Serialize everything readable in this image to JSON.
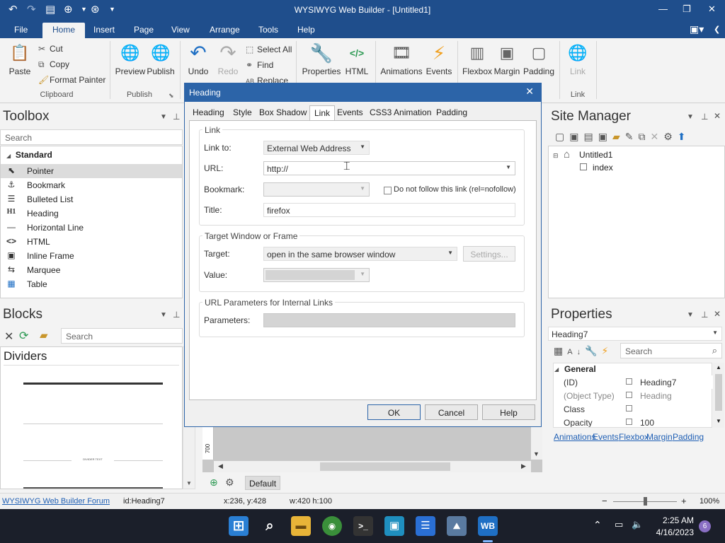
{
  "app": {
    "title": "WYSIWYG Web Builder - [Untitled1]",
    "window_controls": {
      "minimize": "—",
      "maximize": "❐",
      "close": "✕"
    }
  },
  "menu": [
    "File",
    "Home",
    "Insert",
    "Page",
    "View",
    "Arrange",
    "Tools",
    "Help"
  ],
  "ribbon": {
    "paste": "Paste",
    "cut": "Cut",
    "copy": "Copy",
    "format_painter": "Format Painter",
    "clipboard_group": "Clipboard",
    "preview": "Preview",
    "publish": "Publish",
    "publish_group": "Publish",
    "undo": "Undo",
    "redo": "Redo",
    "select_all": "Select All",
    "find": "Find",
    "replace": "Replace",
    "properties": "Properties",
    "html": "HTML",
    "animations": "Animations",
    "events": "Events",
    "flexbox": "Flexbox",
    "margin": "Margin",
    "padding": "Padding",
    "link": "Link",
    "link_group": "Link"
  },
  "toolbox": {
    "title": "Toolbox",
    "search_placeholder": "Search",
    "category": "Standard",
    "items": [
      {
        "icon": "⬉",
        "label": "Pointer"
      },
      {
        "icon": "⚓",
        "label": "Bookmark"
      },
      {
        "icon": "☰",
        "label": "Bulleted List"
      },
      {
        "icon": "H1",
        "label": "Heading"
      },
      {
        "icon": "—",
        "label": "Horizontal Line"
      },
      {
        "icon": "<>",
        "label": "HTML"
      },
      {
        "icon": "▣",
        "label": "Inline Frame"
      },
      {
        "icon": "⇆",
        "label": "Marquee"
      },
      {
        "icon": "▦",
        "label": "Table"
      }
    ]
  },
  "blocks": {
    "title": "Blocks",
    "search_placeholder": "Search",
    "section": "Dividers",
    "divider_caption": "DIVIDER TEXT"
  },
  "dialog": {
    "title": "Heading",
    "tabs": [
      "Heading",
      "Style",
      "Box Shadow",
      "Link",
      "Events",
      "CSS3 Animation",
      "Padding"
    ],
    "active_tab": "Link",
    "link_group": "Link",
    "link_to_label": "Link to:",
    "link_to_value": "External Web Address",
    "url_label": "URL:",
    "url_value": "http://",
    "bookmark_label": "Bookmark:",
    "nofollow_label": "Do not follow this link (rel=nofollow)",
    "title_label": "Title:",
    "title_value": "firefox",
    "target_group": "Target Window or Frame",
    "target_label": "Target:",
    "target_value": "open in the same browser window",
    "settings_button": "Settings...",
    "value_label": "Value:",
    "params_group": "URL Parameters for Internal Links",
    "params_label": "Parameters:",
    "ok": "OK",
    "cancel": "Cancel",
    "help": "Help"
  },
  "canvas": {
    "ruler_label": "700",
    "page_name": "Default"
  },
  "site_manager": {
    "title": "Site Manager",
    "root": "Untitled1",
    "page": "index"
  },
  "properties": {
    "title": "Properties",
    "selected": "Heading7",
    "search_placeholder": "Search",
    "category": "General",
    "rows": [
      {
        "key": "(ID)",
        "value": "Heading7"
      },
      {
        "key": "(Object Type)",
        "value": "Heading"
      },
      {
        "key": "Class",
        "value": ""
      },
      {
        "key": "Opacity",
        "value": "100"
      }
    ],
    "links": [
      "Animations",
      "Events",
      "Flexbox",
      "Margin",
      "Padding"
    ]
  },
  "status": {
    "forum_link": "WYSIWYG Web Builder Forum",
    "id": "id:Heading7",
    "coords": "x:236, y:428",
    "size": "w:420 h:100",
    "zoom": "100%",
    "zoom_level": 0.5
  },
  "taskbar": {
    "time": "2:25 AM",
    "date": "4/16/2023",
    "notifications": "6"
  },
  "colors": {
    "titlebar": "#1f4e8c",
    "dialog_title": "#2c64a8",
    "taskbar": "#1b1f2a"
  }
}
